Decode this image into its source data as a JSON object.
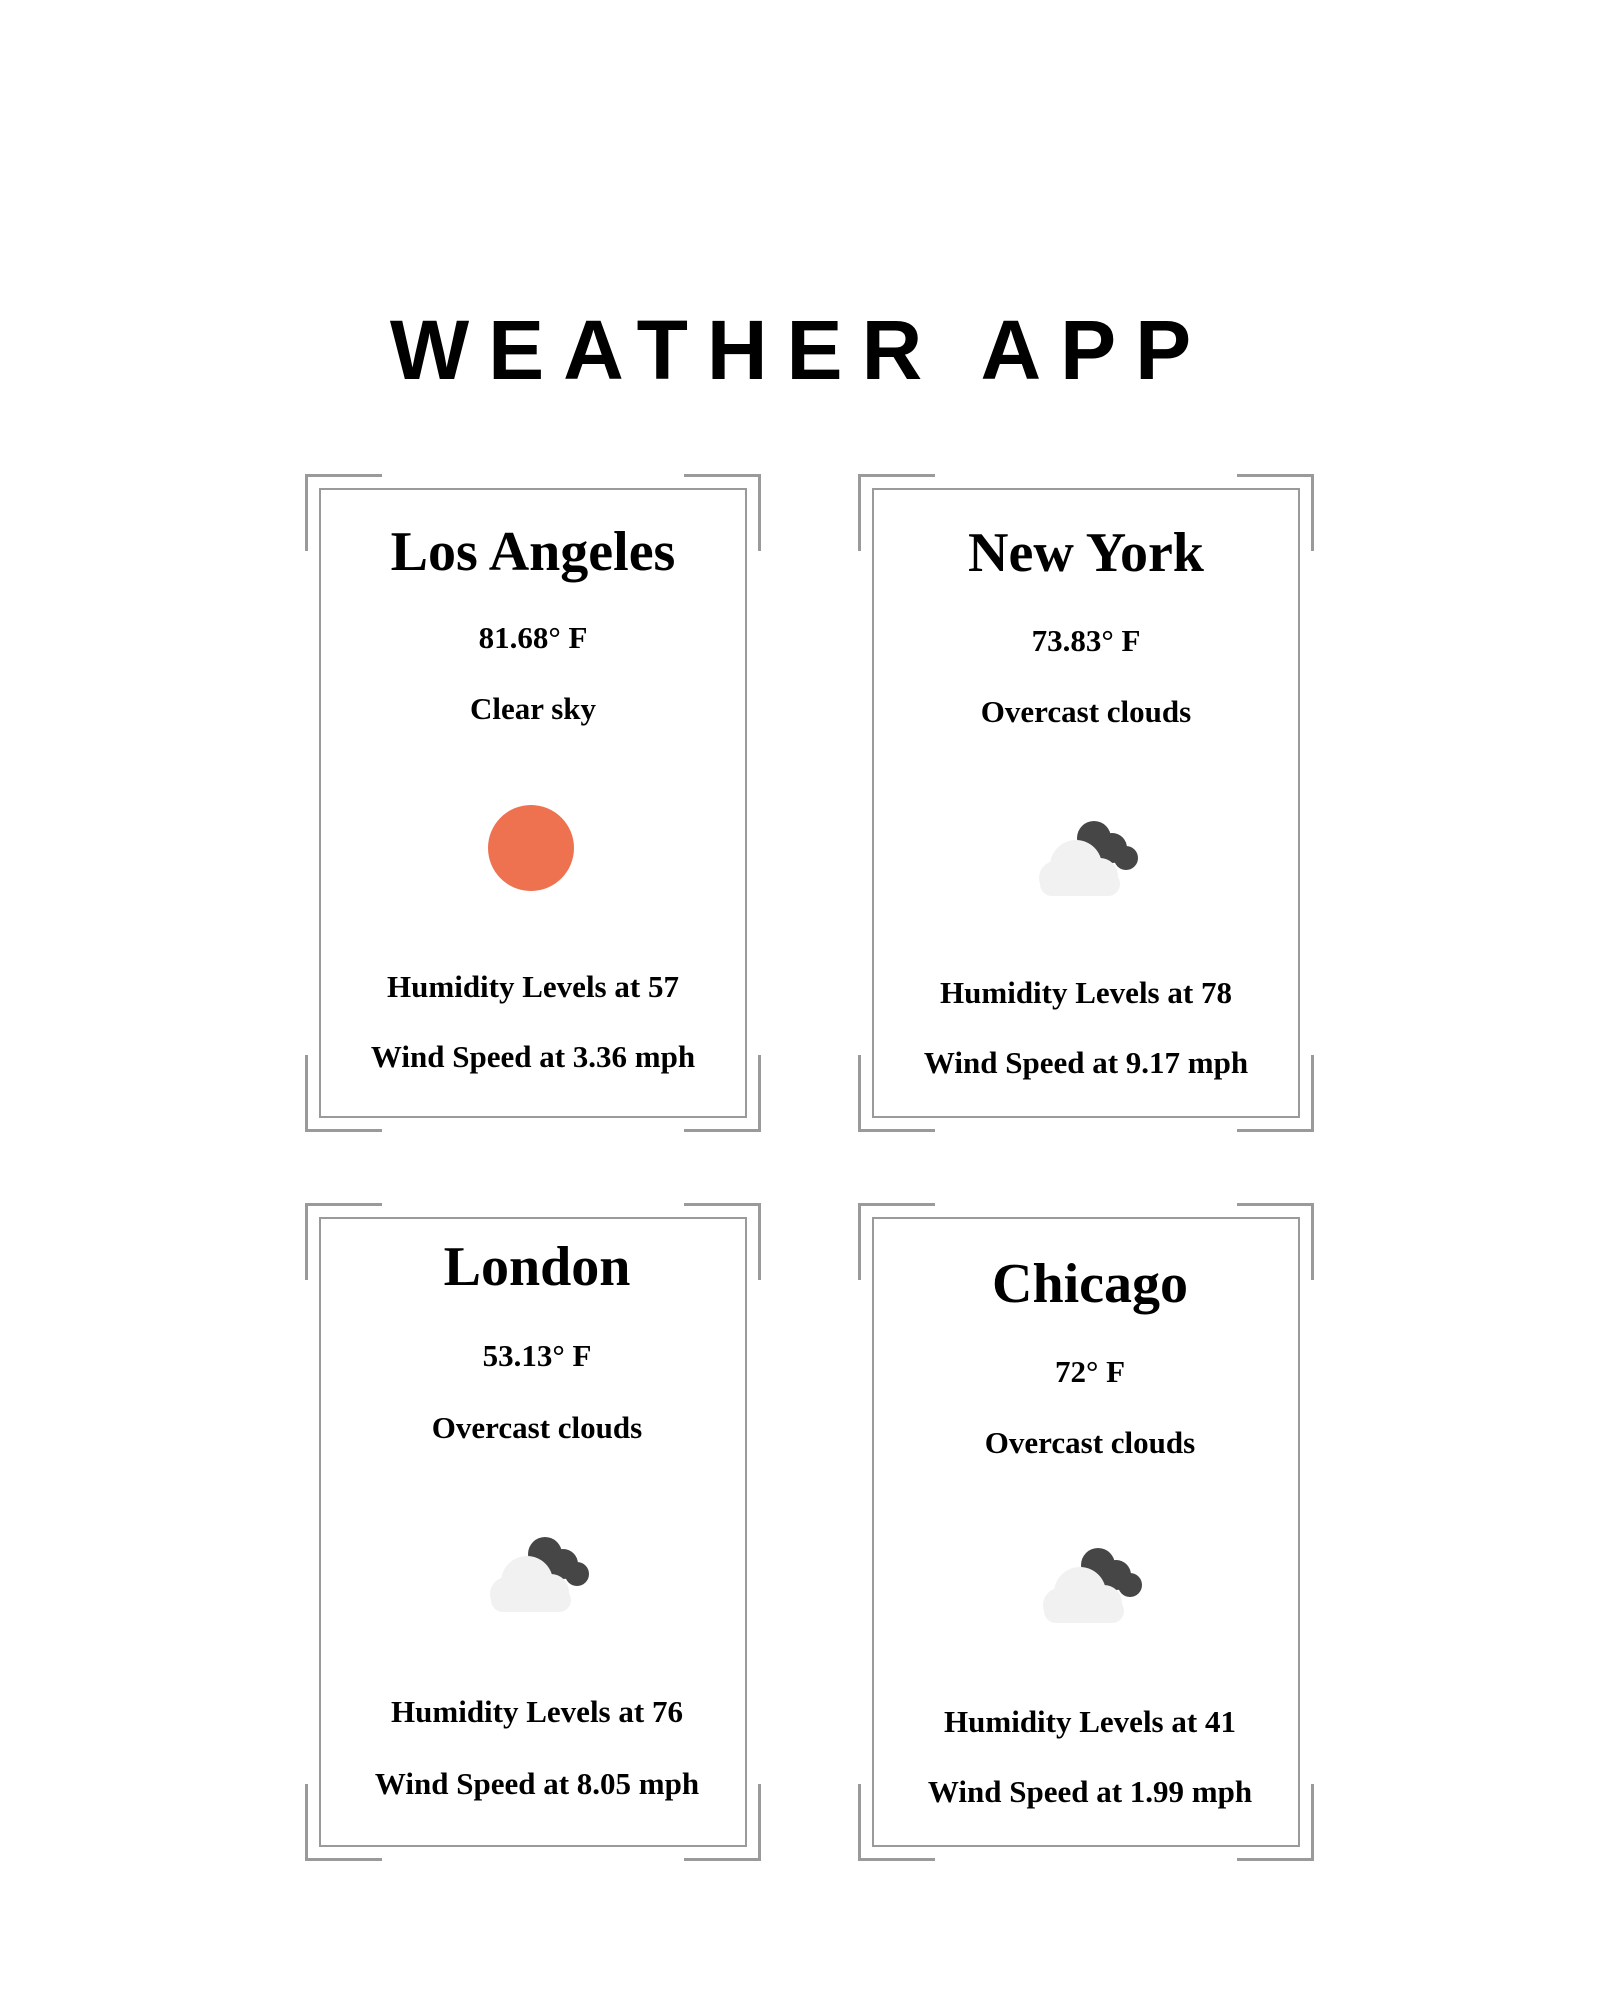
{
  "app": {
    "title": "WEATHER APP"
  },
  "cards": [
    {
      "city": "Los Angeles",
      "temperature": "81.68° F",
      "description": "Clear sky",
      "icon": "sun-icon",
      "humidity": "Humidity Levels at 57",
      "wind": "Wind Speed at 3.36 mph"
    },
    {
      "city": "New York",
      "temperature": "73.83° F",
      "description": "Overcast clouds",
      "icon": "overcast-cloud-icon",
      "humidity": "Humidity Levels at 78",
      "wind": "Wind Speed at 9.17 mph"
    },
    {
      "city": "London",
      "temperature": "53.13° F",
      "description": "Overcast clouds",
      "icon": "overcast-cloud-icon",
      "humidity": "Humidity Levels at 76",
      "wind": "Wind Speed at 8.05 mph"
    },
    {
      "city": "Chicago",
      "temperature": "72° F",
      "description": "Overcast clouds",
      "icon": "overcast-cloud-icon",
      "humidity": "Humidity Levels at 41",
      "wind": "Wind Speed at 1.99 mph"
    }
  ],
  "colors": {
    "sun": "#EE7150",
    "cloud_light": "#F1F1F1",
    "cloud_dark": "#464646",
    "frame": "#9A9A9A"
  }
}
